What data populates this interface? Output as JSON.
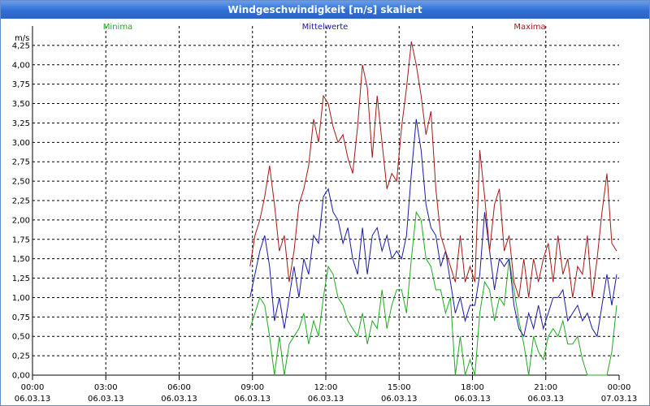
{
  "window": {
    "title": "Windgeschwindigkeit [m/s] skaliert"
  },
  "chart_data": {
    "type": "line",
    "ylabel": "m/s",
    "ylim": [
      0,
      4.5
    ],
    "yticks": [
      "0,00",
      "0,25",
      "0,50",
      "0,75",
      "1,00",
      "1,25",
      "1,50",
      "1,75",
      "2,00",
      "2,25",
      "2,50",
      "2,75",
      "3,00",
      "3,25",
      "3,50",
      "3,75",
      "4,00",
      "4,25"
    ],
    "xlim": [
      0,
      24
    ],
    "xticks": [
      {
        "time": "00:00",
        "date": "06.03.13"
      },
      {
        "time": "03:00",
        "date": "06.03.13"
      },
      {
        "time": "06:00",
        "date": "06.03.13"
      },
      {
        "time": "09:00",
        "date": "06.03.13"
      },
      {
        "time": "12:00",
        "date": "06.03.13"
      },
      {
        "time": "15:00",
        "date": "06.03.13"
      },
      {
        "time": "18:00",
        "date": "06.03.13"
      },
      {
        "time": "21:00",
        "date": "06.03.13"
      },
      {
        "time": "00:00",
        "date": "07.03.13"
      }
    ],
    "grid": true,
    "legend_position": "top",
    "series": [
      {
        "name": "Minima",
        "color": "#22aa22",
        "x": [
          8.9,
          9.1,
          9.3,
          9.5,
          9.7,
          9.9,
          10.1,
          10.3,
          10.5,
          10.7,
          10.9,
          11.1,
          11.3,
          11.5,
          11.7,
          11.9,
          12.1,
          12.3,
          12.5,
          12.7,
          12.9,
          13.1,
          13.3,
          13.5,
          13.7,
          13.9,
          14.1,
          14.3,
          14.5,
          14.7,
          14.9,
          15.1,
          15.3,
          15.5,
          15.7,
          15.9,
          16.1,
          16.3,
          16.5,
          16.7,
          16.9,
          17.1,
          17.3,
          17.5,
          17.7,
          17.9,
          18.1,
          18.3,
          18.5,
          18.7,
          18.9,
          19.1,
          19.3,
          19.5,
          19.7,
          19.9,
          20.1,
          20.3,
          20.5,
          20.7,
          20.9,
          21.1,
          21.3,
          21.5,
          21.7,
          21.9,
          22.1,
          22.3,
          22.5,
          22.7,
          22.9,
          23.1,
          23.3,
          23.5,
          23.7,
          23.9
        ],
        "values": [
          0.6,
          0.8,
          1.0,
          0.9,
          0.5,
          0.0,
          0.5,
          0.0,
          0.4,
          0.5,
          0.6,
          0.8,
          0.4,
          0.7,
          0.5,
          1.0,
          1.4,
          1.3,
          1.0,
          0.9,
          0.7,
          0.6,
          0.5,
          0.8,
          0.4,
          0.7,
          0.6,
          1.1,
          0.6,
          0.9,
          1.1,
          1.1,
          0.8,
          1.5,
          2.1,
          2.0,
          1.5,
          1.4,
          1.1,
          1.1,
          0.8,
          1.0,
          0.0,
          0.5,
          0.0,
          0.2,
          0.0,
          0.8,
          1.2,
          1.1,
          0.7,
          1.0,
          0.9,
          1.5,
          1.1,
          0.7,
          0.4,
          0.0,
          0.5,
          0.3,
          0.2,
          0.5,
          0.6,
          0.5,
          0.7,
          0.4,
          0.4,
          0.5,
          0.2,
          0.0,
          0.0,
          0.0,
          0.0,
          0.0,
          0.3,
          0.9
        ]
      },
      {
        "name": "Mittelwerte",
        "color": "#1a1aa8",
        "x": [
          8.9,
          9.1,
          9.3,
          9.5,
          9.7,
          9.9,
          10.1,
          10.3,
          10.5,
          10.7,
          10.9,
          11.1,
          11.3,
          11.5,
          11.7,
          11.9,
          12.1,
          12.3,
          12.5,
          12.7,
          12.9,
          13.1,
          13.3,
          13.5,
          13.7,
          13.9,
          14.1,
          14.3,
          14.5,
          14.7,
          14.9,
          15.1,
          15.3,
          15.5,
          15.7,
          15.9,
          16.1,
          16.3,
          16.5,
          16.7,
          16.9,
          17.1,
          17.3,
          17.5,
          17.7,
          17.9,
          18.1,
          18.3,
          18.5,
          18.7,
          18.9,
          19.1,
          19.3,
          19.5,
          19.7,
          19.9,
          20.1,
          20.3,
          20.5,
          20.7,
          20.9,
          21.1,
          21.3,
          21.5,
          21.7,
          21.9,
          22.1,
          22.3,
          22.5,
          22.7,
          22.9,
          23.1,
          23.3,
          23.5,
          23.7,
          23.9
        ],
        "values": [
          1.0,
          1.3,
          1.6,
          1.8,
          1.4,
          0.7,
          1.0,
          0.6,
          1.0,
          1.4,
          1.0,
          1.5,
          1.3,
          1.8,
          1.7,
          2.3,
          2.4,
          2.1,
          2.0,
          1.7,
          1.9,
          1.5,
          1.3,
          1.9,
          1.3,
          1.8,
          1.9,
          1.6,
          1.8,
          1.5,
          1.6,
          1.5,
          1.8,
          2.6,
          3.3,
          2.9,
          2.2,
          1.9,
          1.8,
          1.4,
          1.6,
          1.2,
          0.8,
          1.0,
          0.7,
          0.9,
          0.9,
          1.3,
          2.1,
          1.6,
          1.1,
          1.5,
          1.4,
          1.5,
          0.9,
          0.6,
          0.5,
          0.8,
          0.6,
          0.9,
          0.6,
          0.8,
          1.0,
          1.0,
          1.1,
          0.7,
          0.8,
          0.9,
          0.7,
          0.8,
          0.6,
          0.5,
          0.9,
          1.3,
          0.9,
          1.3
        ]
      },
      {
        "name": "Maxima",
        "color": "#a81818",
        "x": [
          8.9,
          9.1,
          9.3,
          9.5,
          9.7,
          9.9,
          10.1,
          10.3,
          10.5,
          10.7,
          10.9,
          11.1,
          11.3,
          11.5,
          11.7,
          11.9,
          12.1,
          12.3,
          12.5,
          12.7,
          12.9,
          13.1,
          13.3,
          13.5,
          13.7,
          13.9,
          14.1,
          14.3,
          14.5,
          14.7,
          14.9,
          15.1,
          15.3,
          15.5,
          15.7,
          15.9,
          16.1,
          16.3,
          16.5,
          16.7,
          16.9,
          17.1,
          17.3,
          17.5,
          17.7,
          17.9,
          18.1,
          18.3,
          18.5,
          18.7,
          18.9,
          19.1,
          19.3,
          19.5,
          19.7,
          19.9,
          20.1,
          20.3,
          20.5,
          20.7,
          20.9,
          21.1,
          21.3,
          21.5,
          21.7,
          21.9,
          22.1,
          22.3,
          22.5,
          22.7,
          22.9,
          23.1,
          23.3,
          23.5,
          23.7,
          23.9
        ],
        "values": [
          1.4,
          1.8,
          2.0,
          2.3,
          2.7,
          2.2,
          1.6,
          1.8,
          1.2,
          1.6,
          2.2,
          2.4,
          2.7,
          3.3,
          3.0,
          3.6,
          3.5,
          3.2,
          3.0,
          3.1,
          2.8,
          2.6,
          3.2,
          4.0,
          3.7,
          2.8,
          3.6,
          3.0,
          2.4,
          2.6,
          2.5,
          3.2,
          3.7,
          4.3,
          4.0,
          3.6,
          3.1,
          3.4,
          2.4,
          1.8,
          1.6,
          1.4,
          1.2,
          1.8,
          1.2,
          1.4,
          1.2,
          2.9,
          2.3,
          1.6,
          2.2,
          2.4,
          1.6,
          1.8,
          1.2,
          1.0,
          1.5,
          1.0,
          1.5,
          1.2,
          1.5,
          1.7,
          1.2,
          1.8,
          1.3,
          1.5,
          1.0,
          1.4,
          1.3,
          1.8,
          1.0,
          1.5,
          2.1,
          2.6,
          1.7,
          1.6
        ]
      }
    ]
  }
}
